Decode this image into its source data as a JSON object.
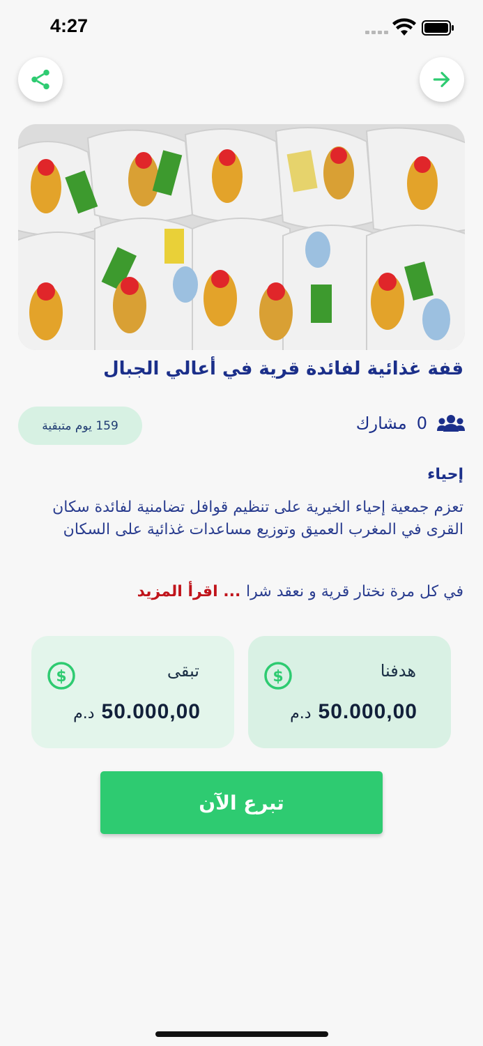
{
  "status_bar": {
    "time": "4:27"
  },
  "header": {
    "share_icon": "share-icon",
    "forward_icon": "arrow-right-icon",
    "accent": "#2ecb71"
  },
  "campaign": {
    "title": "قفة غذائية لفائدة قرية في أعالي الجبال",
    "days_left": "159 يوم متبقية",
    "participants_count": "0",
    "participants_label": "مشارك",
    "organization": "إحياء",
    "description": "تعزم جمعية إحياء الخيرية على تنظيم قوافل تضامنية لفائدة سكان القرى في المغرب العميق وتوزيع مساعدات غذائية على السكان",
    "teaser": "في كل مرة نختار قرية و نعقد شرا",
    "ellipsis": " ... ",
    "read_more": "اقرأ المزيد"
  },
  "stats": {
    "goal": {
      "label": "هدفنا",
      "value": "50.000,00",
      "currency": "د.م"
    },
    "remaining": {
      "label": "تبقى",
      "value": "50.000,00",
      "currency": "د.م"
    }
  },
  "actions": {
    "donate_label": "تبرع الآن"
  }
}
